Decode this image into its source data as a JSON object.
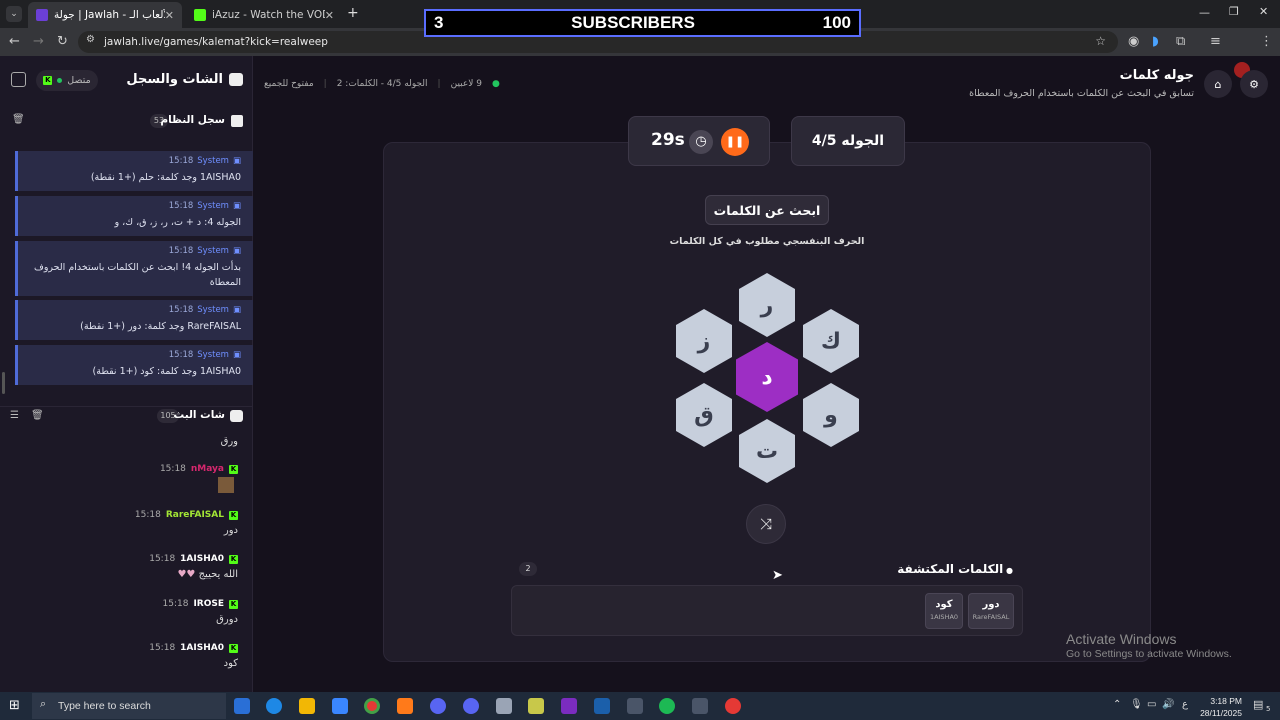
{
  "browser": {
    "tabs": [
      {
        "label": "جولة | Jawlah - منصة الألعاب الـ",
        "active": true
      },
      {
        "label": "iAzuz - Watch the VOD on Kick",
        "active": false
      }
    ],
    "url": "jawlah.live/games/kalemat?kick=realweep"
  },
  "overlay": {
    "left": "3",
    "center": "SUBSCRIBERS",
    "right": "100"
  },
  "sidebar": {
    "title": "الشات والسجل",
    "connection": "متصل",
    "system_log": {
      "title": "سجل النظام",
      "count": "53",
      "messages": [
        {
          "sender": "System",
          "time": "15:18",
          "text": "1AISHA0 وجد كلمة: حلم (+1 نقطة)"
        },
        {
          "sender": "System",
          "time": "15:18",
          "text": "الجوله 4: د + ت، ر، ز، ق، ك، و"
        },
        {
          "sender": "System",
          "time": "15:18",
          "text": "بدأت الجوله 4! ابحث عن الكلمات باستخدام الحروف المعطاة"
        },
        {
          "sender": "System",
          "time": "15:18",
          "text": "RareFAISAL وجد كلمة: دور (+1 نقطة)"
        },
        {
          "sender": "System",
          "time": "15:18",
          "text": "1AISHA0 وجد كلمة: كود (+1 نقطة)"
        }
      ]
    },
    "stream_chat": {
      "title": "شات البث",
      "count": "105",
      "messages": [
        {
          "user": "",
          "time": "",
          "text": "ورق",
          "color": "#ffffff"
        },
        {
          "user": "nMaya",
          "time": "15:18",
          "text": "",
          "color": "#d6276e"
        },
        {
          "user": "RareFAISAL",
          "time": "15:18",
          "text": "دور",
          "color": "#a3e635"
        },
        {
          "user": "1AISHA0",
          "time": "15:18",
          "text": "الله يحييج",
          "color": "#ffffff"
        },
        {
          "user": "IROSE",
          "time": "15:18",
          "text": "دورق",
          "color": "#ffffff"
        },
        {
          "user": "1AISHA0",
          "time": "15:18",
          "text": "كود",
          "color": "#ffffff"
        }
      ]
    }
  },
  "game": {
    "title": "جوله كلمات",
    "subtitle": "تسابق في البحث عن الكلمات باستخدام الحروف المعطاة",
    "status": {
      "players": "9 لاعبين",
      "round_words": "الجوله 4/5 - الكلمات: 2",
      "mode": "مفتوح للجميع"
    },
    "round": "الجوله 4/5",
    "timer": "29s",
    "search_label": "ابحث عن الكلمات",
    "hint": "الحرف البنفسجي مطلوب في كل الكلمات",
    "center_letter": "د",
    "letters": {
      "top": "ر",
      "top_right": "ك",
      "bottom_right": "و",
      "bottom": "ت",
      "bottom_left": "ق",
      "top_left": "ز"
    },
    "found_title": "الكلمات المكتشفة",
    "found_count": "2",
    "found_words": [
      {
        "word": "دور",
        "user": "RareFAISAL"
      },
      {
        "word": "كود",
        "user": "1AISHA0"
      }
    ]
  },
  "watermark": {
    "line1": "Activate Windows",
    "line2": "Go to Settings to activate Windows."
  },
  "taskbar": {
    "search_placeholder": "Type here to search",
    "time": "3:18 PM",
    "date": "28/11/2025",
    "lang": "ع",
    "notif": "5"
  },
  "colors": {
    "accent": "#9d2ec4",
    "kick": "#53fc18",
    "system_border": "#4f6bd8"
  }
}
